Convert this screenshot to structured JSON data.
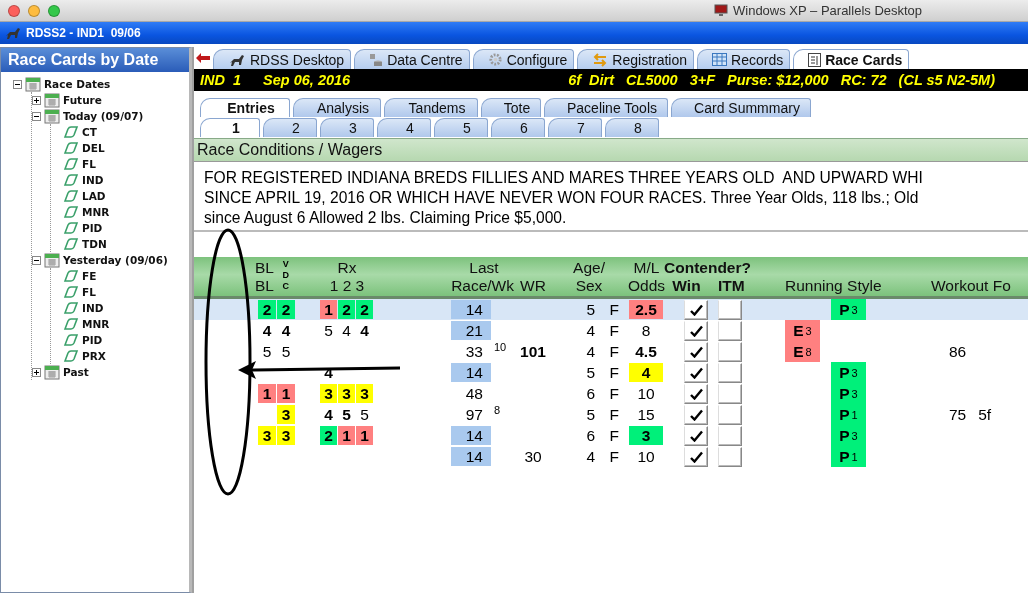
{
  "mac_window": {
    "title": "Windows XP – Parallels Desktop"
  },
  "app_window": {
    "title": "RDSS2 - IND1  09/06"
  },
  "sidebar": {
    "title": "Race Cards by Date",
    "tree": [
      {
        "label": "Race Dates",
        "kind": "date",
        "expanded": true,
        "children": [
          {
            "label": "Future",
            "kind": "date",
            "expanded": false
          },
          {
            "label": "Today (09/07)",
            "kind": "date",
            "expanded": true,
            "children": [
              {
                "label": "CT",
                "kind": "track"
              },
              {
                "label": "DEL",
                "kind": "track"
              },
              {
                "label": "FL",
                "kind": "track"
              },
              {
                "label": "IND",
                "kind": "track"
              },
              {
                "label": "LAD",
                "kind": "track"
              },
              {
                "label": "MNR",
                "kind": "track"
              },
              {
                "label": "PID",
                "kind": "track"
              },
              {
                "label": "TDN",
                "kind": "track"
              }
            ]
          },
          {
            "label": "Yesterday (09/06)",
            "kind": "date",
            "expanded": true,
            "children": [
              {
                "label": "FE",
                "kind": "track"
              },
              {
                "label": "FL",
                "kind": "track"
              },
              {
                "label": "IND",
                "kind": "track"
              },
              {
                "label": "MNR",
                "kind": "track"
              },
              {
                "label": "PID",
                "kind": "track"
              },
              {
                "label": "PRX",
                "kind": "track"
              }
            ]
          },
          {
            "label": "Past",
            "kind": "date",
            "expanded": false
          }
        ]
      }
    ]
  },
  "main_tabs": [
    {
      "label": "RDSS Desktop",
      "selected": false
    },
    {
      "label": "Data Centre",
      "selected": false
    },
    {
      "label": "Configure",
      "selected": false
    },
    {
      "label": "Registration",
      "selected": false
    },
    {
      "label": "Records",
      "selected": false
    },
    {
      "label": "Race Cards",
      "selected": true
    }
  ],
  "race_header": {
    "race": "IND  1",
    "date": "Sep 06, 2016",
    "details": [
      "6f  Dirt",
      "CL5000",
      "3+F",
      "Purse: $12,000",
      "RC: 72",
      "(CL s5 N2-5M)"
    ]
  },
  "view_tabs": [
    {
      "label": "Entries",
      "selected": true
    },
    {
      "label": "Analysis",
      "selected": false
    },
    {
      "label": "Tandems",
      "selected": false
    },
    {
      "label": "Tote",
      "selected": false
    },
    {
      "label": "Paceline Tools",
      "selected": false
    },
    {
      "label": "Card Summmary",
      "selected": false
    }
  ],
  "race_tabs": [
    {
      "label": "1",
      "selected": true
    },
    {
      "label": "2",
      "selected": false
    },
    {
      "label": "3",
      "selected": false
    },
    {
      "label": "4",
      "selected": false
    },
    {
      "label": "5",
      "selected": false
    },
    {
      "label": "6",
      "selected": false
    },
    {
      "label": "7",
      "selected": false
    },
    {
      "label": "8",
      "selected": false
    }
  ],
  "conditions": {
    "title": "Race Conditions / Wagers",
    "lines": [
      "FOR REGISTERED INDIANA BREDS FILLIES AND MARES THREE YEARS OLD  AND UPWARD WHI",
      "SINCE APRIL 19, 2016 OR WHICH HAVE NEVER WON FOUR RACES. Three Year Olds, 118 lbs.; Old",
      "since August 6 Allowed 2 lbs. Claiming Price $5,000."
    ]
  },
  "table": {
    "header": {
      "bl": [
        "BL",
        "BL"
      ],
      "vdc": [
        "V",
        "D",
        "C"
      ],
      "rx": "Rx",
      "rx_nums": "1 2 3",
      "last": [
        "Last",
        "Race/Wk"
      ],
      "wr": "WR",
      "age_sex": [
        "Age/",
        "Sex"
      ],
      "odds": [
        "M/L",
        "Odds"
      ],
      "contender": "Contender?",
      "win": "Win",
      "itm": "ITM",
      "style": "Running Style",
      "workout": "Workout Fo"
    },
    "rows": [
      {
        "selected": true,
        "bl_1": {
          "text": "2",
          "color": "#00f07a",
          "bold": true
        },
        "bl_2": {
          "text": "2",
          "color": "#00f07a",
          "bold": true
        },
        "rx_1": {
          "text": "1",
          "color": "#ff8080",
          "bold": true
        },
        "rx_2": {
          "text": "2",
          "color": "#00f07a",
          "bold": true
        },
        "rx_3": {
          "text": "2",
          "color": "#00f07a",
          "bold": true
        },
        "last": {
          "text": "14",
          "highlighted": true
        },
        "age": "5",
        "sex": "F",
        "odds": {
          "text": "2.5",
          "color": "#ff8080",
          "bold": true
        },
        "win": true,
        "itm": false,
        "style": {
          "text": "P",
          "sup": "3",
          "color": "#00f07a",
          "kind": "presser"
        }
      },
      {
        "selected": false,
        "bl_1": {
          "text": "4",
          "bold": true
        },
        "bl_2": {
          "text": "4",
          "bold": true
        },
        "rx_1": {
          "text": "5",
          "bold": false
        },
        "rx_2": {
          "text": "4",
          "bold": false
        },
        "rx_3": {
          "text": "4",
          "bold": true
        },
        "last": {
          "text": "21",
          "highlighted": true
        },
        "age": "4",
        "sex": "F",
        "odds": {
          "text": "8",
          "bold": false
        },
        "win": true,
        "itm": false,
        "style": {
          "text": "E",
          "sup": "3",
          "color": "#ff8080",
          "kind": "early"
        }
      },
      {
        "selected": false,
        "bl_1": {
          "text": "5",
          "bold": false
        },
        "bl_2": {
          "text": "5",
          "bold": false
        },
        "last": {
          "text": "33",
          "sup": "10",
          "highlighted": false
        },
        "wr": {
          "text": "101",
          "bold": true
        },
        "age": "4",
        "sex": "F",
        "odds": {
          "text": "4.5",
          "bold": true
        },
        "win": true,
        "itm": false,
        "style": {
          "text": "E",
          "sup": "8",
          "color": "#ff8080",
          "kind": "early"
        },
        "workout": [
          "86"
        ]
      },
      {
        "selected": false,
        "rx_1": {
          "text": "4",
          "bold": true
        },
        "last": {
          "text": "14",
          "highlighted": true
        },
        "age": "5",
        "sex": "F",
        "odds": {
          "text": "4",
          "color": "#ffff00",
          "bold": true
        },
        "win": true,
        "itm": false,
        "style": {
          "text": "P",
          "sup": "3",
          "color": "#00f07a",
          "kind": "presser"
        }
      },
      {
        "selected": false,
        "bl_1": {
          "text": "1",
          "color": "#ff8080",
          "bold": true
        },
        "bl_2": {
          "text": "1",
          "color": "#ff8080",
          "bold": true
        },
        "rx_1": {
          "text": "3",
          "color": "#ffff00",
          "bold": true
        },
        "rx_2": {
          "text": "3",
          "color": "#ffff00",
          "bold": true
        },
        "rx_3": {
          "text": "3",
          "color": "#ffff00",
          "bold": true
        },
        "last": {
          "text": "48",
          "highlighted": false
        },
        "age": "6",
        "sex": "F",
        "odds": {
          "text": "10",
          "bold": false
        },
        "win": true,
        "itm": false,
        "style": {
          "text": "P",
          "sup": "3",
          "color": "#00f07a",
          "kind": "presser"
        }
      },
      {
        "selected": false,
        "bl_2": {
          "text": "3",
          "color": "#ffff00",
          "bold": true
        },
        "rx_1": {
          "text": "4",
          "bold": true
        },
        "rx_2": {
          "text": "5",
          "bold": true
        },
        "rx_3": {
          "text": "5",
          "bold": false
        },
        "last": {
          "text": "97",
          "sup": "8",
          "highlighted": false
        },
        "age": "5",
        "sex": "F",
        "odds": {
          "text": "15",
          "bold": false
        },
        "win": true,
        "itm": false,
        "style": {
          "text": "P",
          "sup": "1",
          "color": "#00f07a",
          "kind": "presser"
        },
        "workout": [
          "75",
          "5f"
        ]
      },
      {
        "selected": false,
        "bl_1": {
          "text": "3",
          "color": "#ffff00",
          "bold": true
        },
        "bl_2": {
          "text": "3",
          "color": "#ffff00",
          "bold": true
        },
        "rx_1": {
          "text": "2",
          "color": "#00f07a",
          "bold": true
        },
        "rx_2": {
          "text": "1",
          "color": "#ff8080",
          "bold": true
        },
        "rx_3": {
          "text": "1",
          "color": "#ff8080",
          "bold": true
        },
        "last": {
          "text": "14",
          "highlighted": true
        },
        "age": "6",
        "sex": "F",
        "odds": {
          "text": "3",
          "color": "#00f07a",
          "bold": true
        },
        "win": true,
        "itm": false,
        "style": {
          "text": "P",
          "sup": "3",
          "color": "#00f07a",
          "kind": "presser"
        }
      },
      {
        "selected": false,
        "last": {
          "text": "14",
          "highlighted": true
        },
        "wr": {
          "text": "30",
          "bold": false
        },
        "age": "4",
        "sex": "F",
        "odds": {
          "text": "10",
          "bold": false
        },
        "win": true,
        "itm": false,
        "style": {
          "text": "P",
          "sup": "1",
          "color": "#00f07a",
          "kind": "presser"
        }
      }
    ]
  }
}
